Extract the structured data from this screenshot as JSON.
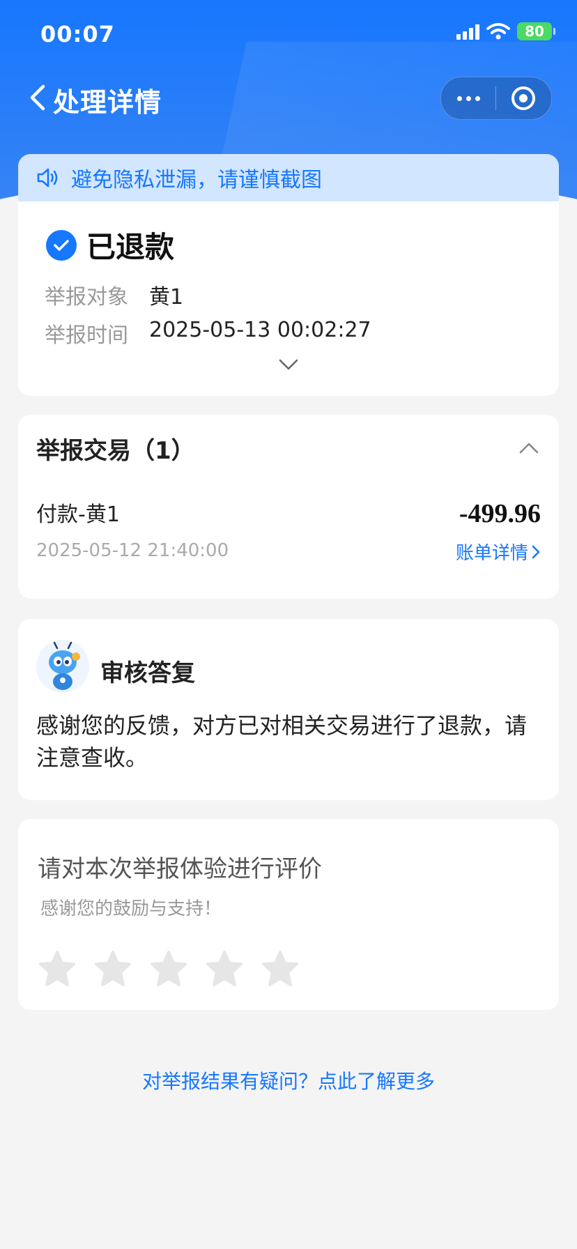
{
  "status_bar": {
    "time": "00:07",
    "battery": "80"
  },
  "nav": {
    "title": "处理详情"
  },
  "notice": {
    "text": "避免隐私泄漏，请谨慎截图"
  },
  "status": {
    "title": "已退款",
    "target_label": "举报对象",
    "target_value": "黄1",
    "time_label": "举报时间",
    "time_value": "2025-05-13 00:02:27"
  },
  "trade": {
    "title": "举报交易（1）",
    "name": "付款-黄1",
    "amount": "-499.96",
    "date": "2025-05-12 21:40:00",
    "bill_link": "账单详情"
  },
  "reply": {
    "title": "审核答复",
    "text": "感谢您的反馈，对方已对相关交易进行了退款，请注意查收。"
  },
  "rating": {
    "title": "请对本次举报体验进行评价",
    "subtitle": "感谢您的鼓励与支持！",
    "max_stars": 5,
    "selected_stars": 0
  },
  "footer": {
    "link": "对举报结果有疑问？点此了解更多"
  },
  "colors": {
    "brand": "#1677ff",
    "background": "#f4f4f5",
    "star_empty": "#e6e6e6"
  }
}
